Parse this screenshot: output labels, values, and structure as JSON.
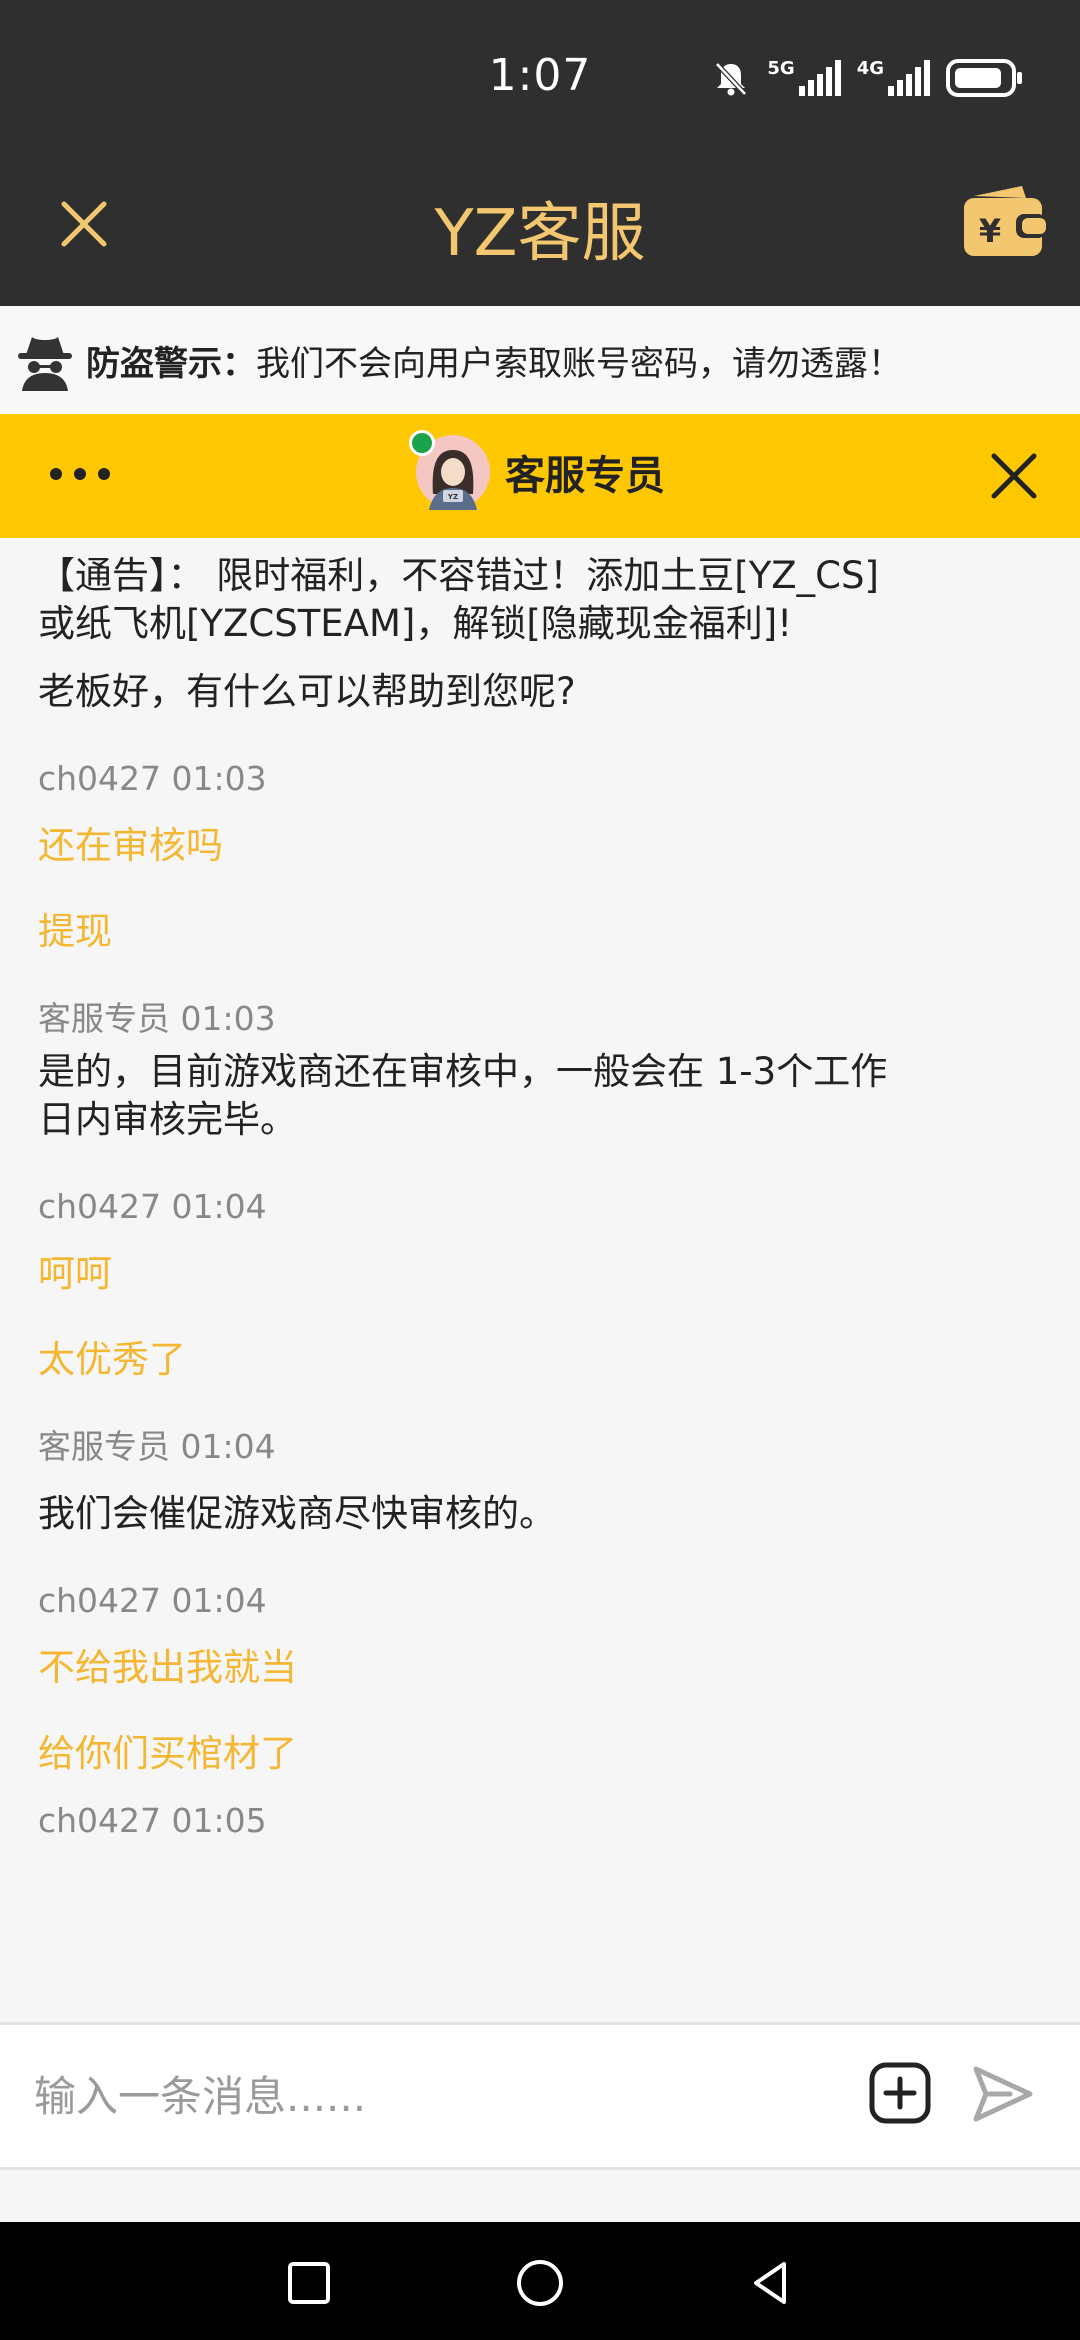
{
  "status_bar": {
    "time": "1:07",
    "network_1": "5G",
    "network_2": "4G"
  },
  "header": {
    "title": "YZ客服"
  },
  "warning": {
    "label": "防盗警示：",
    "text": "我们不会向用户索取账号密码，请勿透露！"
  },
  "agent_bar": {
    "name": "客服专员",
    "avatar_text": "YZ"
  },
  "chat": {
    "notice": "【通告】：  限时福利，不容错过！添加土豆[YZ_CS]或纸飞机[YZCSTEAM]，解锁[隐藏现金福利]!",
    "greeting": "老板好，有什么可以帮助到您呢?",
    "groups": [
      {
        "meta": "ch0427 01:03",
        "messages": [
          "还在审核吗",
          "提现"
        ]
      },
      {
        "meta": "客服专员 01:03",
        "messages": [
          "是的，目前游戏商还在审核中，一般会在 1-3个工作日内审核完毕。"
        ]
      },
      {
        "meta": "ch0427 01:04",
        "messages": [
          "呵呵",
          "太优秀了"
        ]
      },
      {
        "meta": "客服专员 01:04",
        "messages": [
          "我们会催促游戏商尽快审核的。"
        ]
      },
      {
        "meta": "ch0427 01:04",
        "messages": [
          "不给我出我就当",
          "给你们买棺材了"
        ]
      },
      {
        "meta": "ch0427 01:05",
        "messages": []
      }
    ]
  },
  "input": {
    "placeholder": "输入一条消息......"
  },
  "colors": {
    "header_bg": "#2f2f2f",
    "accent_gold": "#f3c670",
    "agent_bar_bg": "#fdc702",
    "user_msg": "#f5b631"
  }
}
